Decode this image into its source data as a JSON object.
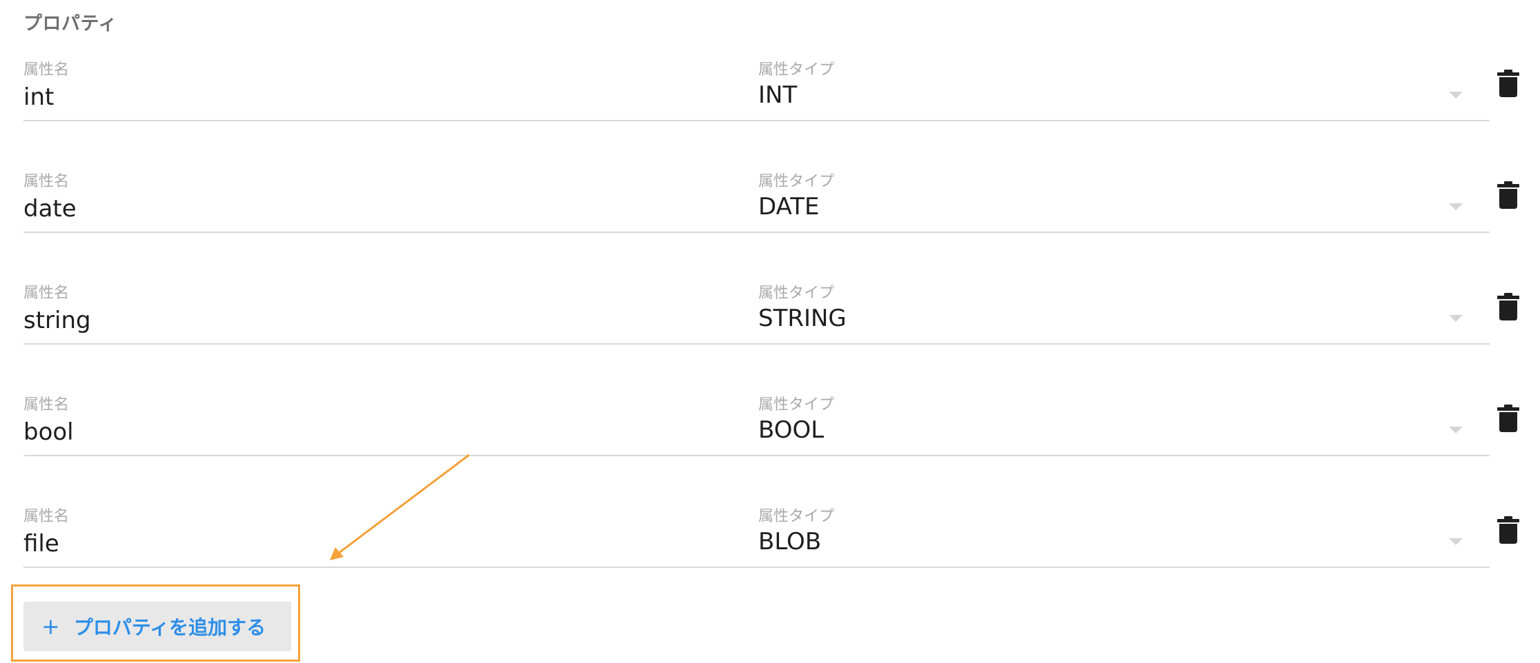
{
  "section": {
    "title": "プロパティ"
  },
  "labels": {
    "name": "属性名",
    "type": "属性タイプ"
  },
  "properties": [
    {
      "name": "int",
      "type": "INT"
    },
    {
      "name": "date",
      "type": "DATE"
    },
    {
      "name": "string",
      "type": "STRING"
    },
    {
      "name": "bool",
      "type": "BOOL"
    },
    {
      "name": "file",
      "type": "BLOB"
    }
  ],
  "add_button": {
    "icon": "plus-icon",
    "label": "プロパティを追加する"
  },
  "annotations": {
    "highlight_color": "#f6a13a",
    "arrow_color": "#f6a13a"
  },
  "colors": {
    "accent": "#2d8ee8",
    "text": "#1e1e1e",
    "muted": "#a9a9a9"
  }
}
